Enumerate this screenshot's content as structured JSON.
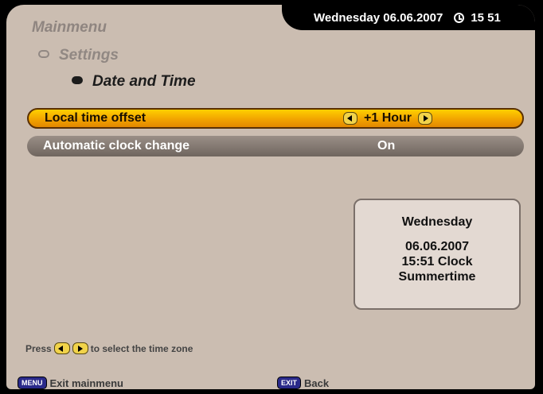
{
  "header": {
    "datetime": "Wednesday 06.06.2007",
    "time": "15 51"
  },
  "breadcrumb": {
    "level1": "Mainmenu",
    "level2": "Settings",
    "level3": "Date and Time"
  },
  "settings": [
    {
      "label": "Local time offset",
      "value": "+1 Hour"
    },
    {
      "label": "Automatic clock change",
      "value": "On"
    }
  ],
  "info": {
    "day": "Wednesday",
    "date": "06.06.2007",
    "time": "15:51 Clock",
    "mode": "Summertime"
  },
  "hint": {
    "prefix": "Press",
    "suffix": "to select the time zone"
  },
  "footer": {
    "menu_key": "MENU",
    "menu_label": "Exit mainmenu",
    "exit_key": "EXIT",
    "exit_label": "Back"
  }
}
